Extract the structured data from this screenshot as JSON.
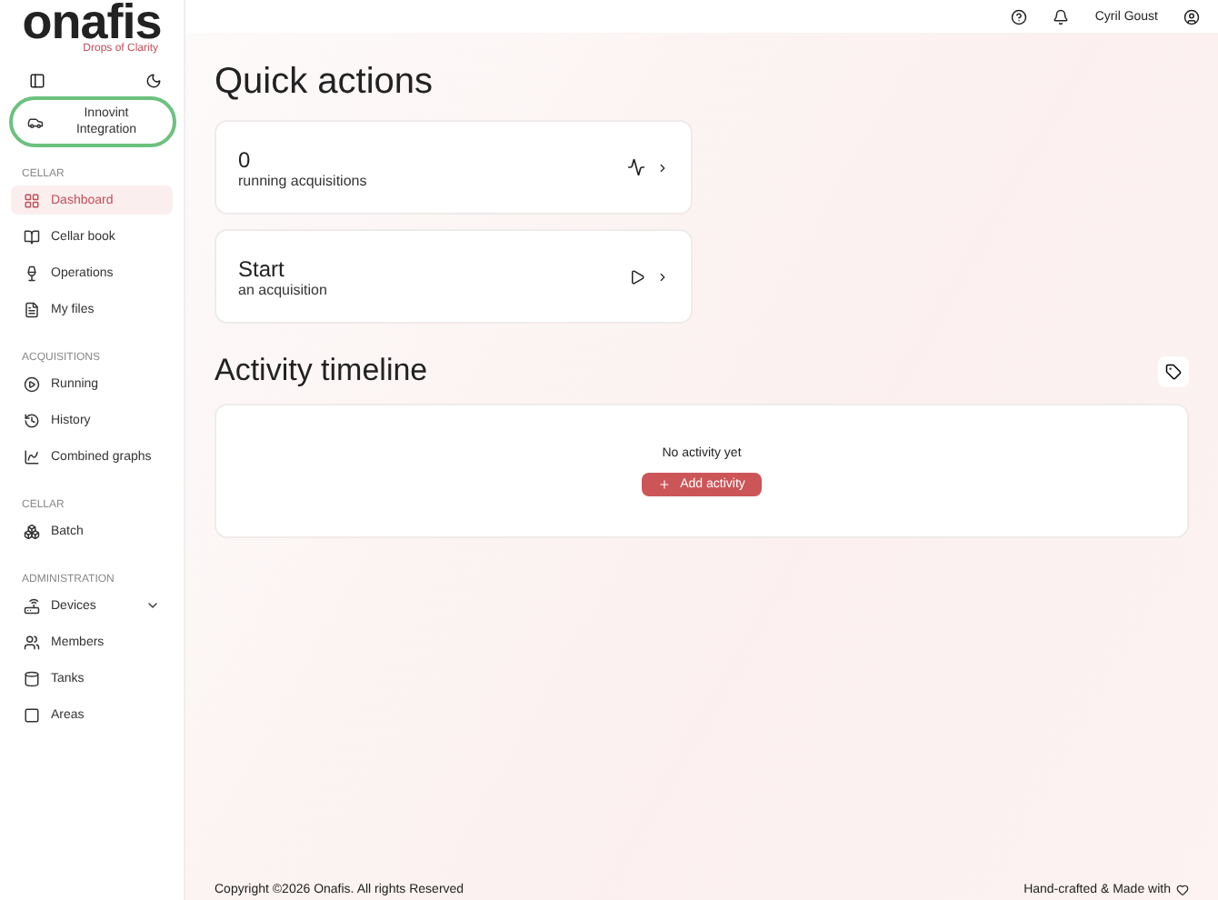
{
  "logo": {
    "name": "onafis",
    "tagline": "Drops of Clarity"
  },
  "integration": {
    "label": "Innovint Integration",
    "highlighted": true
  },
  "sidebar": {
    "sections": [
      {
        "title": "CELLAR",
        "items": [
          {
            "label": "Dashboard",
            "selected": true
          },
          {
            "label": "Cellar book",
            "selected": false
          },
          {
            "label": "Operations",
            "selected": false
          },
          {
            "label": "My files",
            "selected": false
          }
        ]
      },
      {
        "title": "ACQUISITIONS",
        "items": [
          {
            "label": "Running",
            "selected": false
          },
          {
            "label": "History",
            "selected": false
          },
          {
            "label": "Combined graphs",
            "selected": false
          }
        ]
      },
      {
        "title": "CELLAR",
        "items": [
          {
            "label": "Batch",
            "selected": false
          }
        ]
      },
      {
        "title": "ADMINISTRATION",
        "items": [
          {
            "label": "Devices",
            "selected": false,
            "expanded": false
          },
          {
            "label": "Members",
            "selected": false
          },
          {
            "label": "Tanks",
            "selected": false
          },
          {
            "label": "Areas",
            "selected": false
          }
        ]
      }
    ]
  },
  "topbar": {
    "user": "Cyril Goust"
  },
  "quick_actions": {
    "title": "Quick actions",
    "cards": [
      {
        "kind": "pulse",
        "title": "0",
        "subtitle": "running acquisitions"
      },
      {
        "kind": "play",
        "title": "Start",
        "subtitle": "an acquisition"
      }
    ]
  },
  "activity": {
    "title": "Activity timeline",
    "empty": "No activity yet",
    "button": "Add activity"
  },
  "footer": {
    "copyright": "Copyright ©2026 Onafis. All rights Reserved",
    "credit": "Hand-crafted & Made with"
  }
}
